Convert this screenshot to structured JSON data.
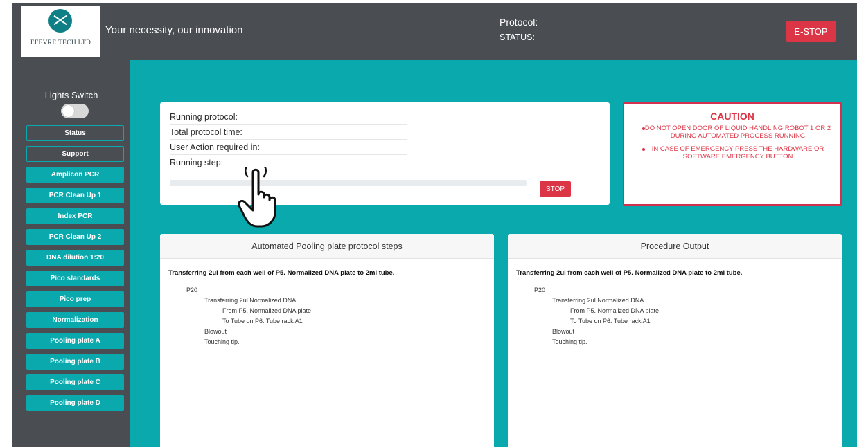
{
  "header": {
    "logo_text": "EFEVRE TECH LTD",
    "tagline": "Your necessity, our innovation",
    "protocol_label": "Protocol:",
    "status_label": "STATUS:",
    "estop_label": "E-STOP"
  },
  "sidebar": {
    "lights_label": "Lights Switch",
    "lights_on": false,
    "items": [
      {
        "label": "Status",
        "style": "dark"
      },
      {
        "label": "Support",
        "style": "dark"
      },
      {
        "label": "Amplicon PCR",
        "style": "teal"
      },
      {
        "label": "PCR Clean Up 1",
        "style": "teal"
      },
      {
        "label": "Index PCR",
        "style": "teal"
      },
      {
        "label": "PCR Clean Up 2",
        "style": "teal"
      },
      {
        "label": "DNA dilution 1:20",
        "style": "teal"
      },
      {
        "label": "Pico standards",
        "style": "teal"
      },
      {
        "label": "Pico prep",
        "style": "teal"
      },
      {
        "label": "Normalization",
        "style": "teal"
      },
      {
        "label": "Pooling plate A",
        "style": "teal"
      },
      {
        "label": "Pooling plate B",
        "style": "teal"
      },
      {
        "label": "Pooling plate C",
        "style": "teal"
      },
      {
        "label": "Pooling plate D",
        "style": "teal"
      }
    ]
  },
  "run": {
    "running_protocol": "Running protocol:",
    "total_time": "Total protocol time:",
    "user_action": "User Action required in:",
    "running_step": "Running step:",
    "progress_percent": 0,
    "stop_label": "STOP"
  },
  "caution": {
    "title": "CAUTION",
    "item1": "DO NOT OPEN DOOR OF LIQUID HANDLING ROBOT 1 OR 2 DURING AUTOMATED PROCESS RUNNING",
    "item2": "IN CASE OF EMERGENCY PRESS THE HARDWARE OR SOFTWARE EMERGENCY BUTTON"
  },
  "steps_panel": {
    "title": "Automated Pooling plate protocol steps",
    "heading": "Transferring 2ul from each well of P5. Normalized DNA plate to 2ml tube.",
    "l1": "P20",
    "l2": "Transferring 2ul Normalized DNA",
    "l3": "From P5. Normalized DNA plate",
    "l4": "To Tube on P6. Tube rack A1",
    "l5": "Blowout",
    "l6": "Touching tip."
  },
  "output_panel": {
    "title": "Procedure Output",
    "heading": "Transferring 2ul from each well of P5. Normalized DNA plate to 2ml tube.",
    "l1": "P20",
    "l2": "Transferring 2ul Normalized DNA",
    "l3": "From P5. Normalized DNA plate",
    "l4": "To Tube on P6. Tube rack A1",
    "l5": "Blowout",
    "l6": "Touching tip."
  },
  "colors": {
    "teal": "#0aa9ae",
    "dark": "#4a4d51",
    "danger": "#dc3545"
  }
}
